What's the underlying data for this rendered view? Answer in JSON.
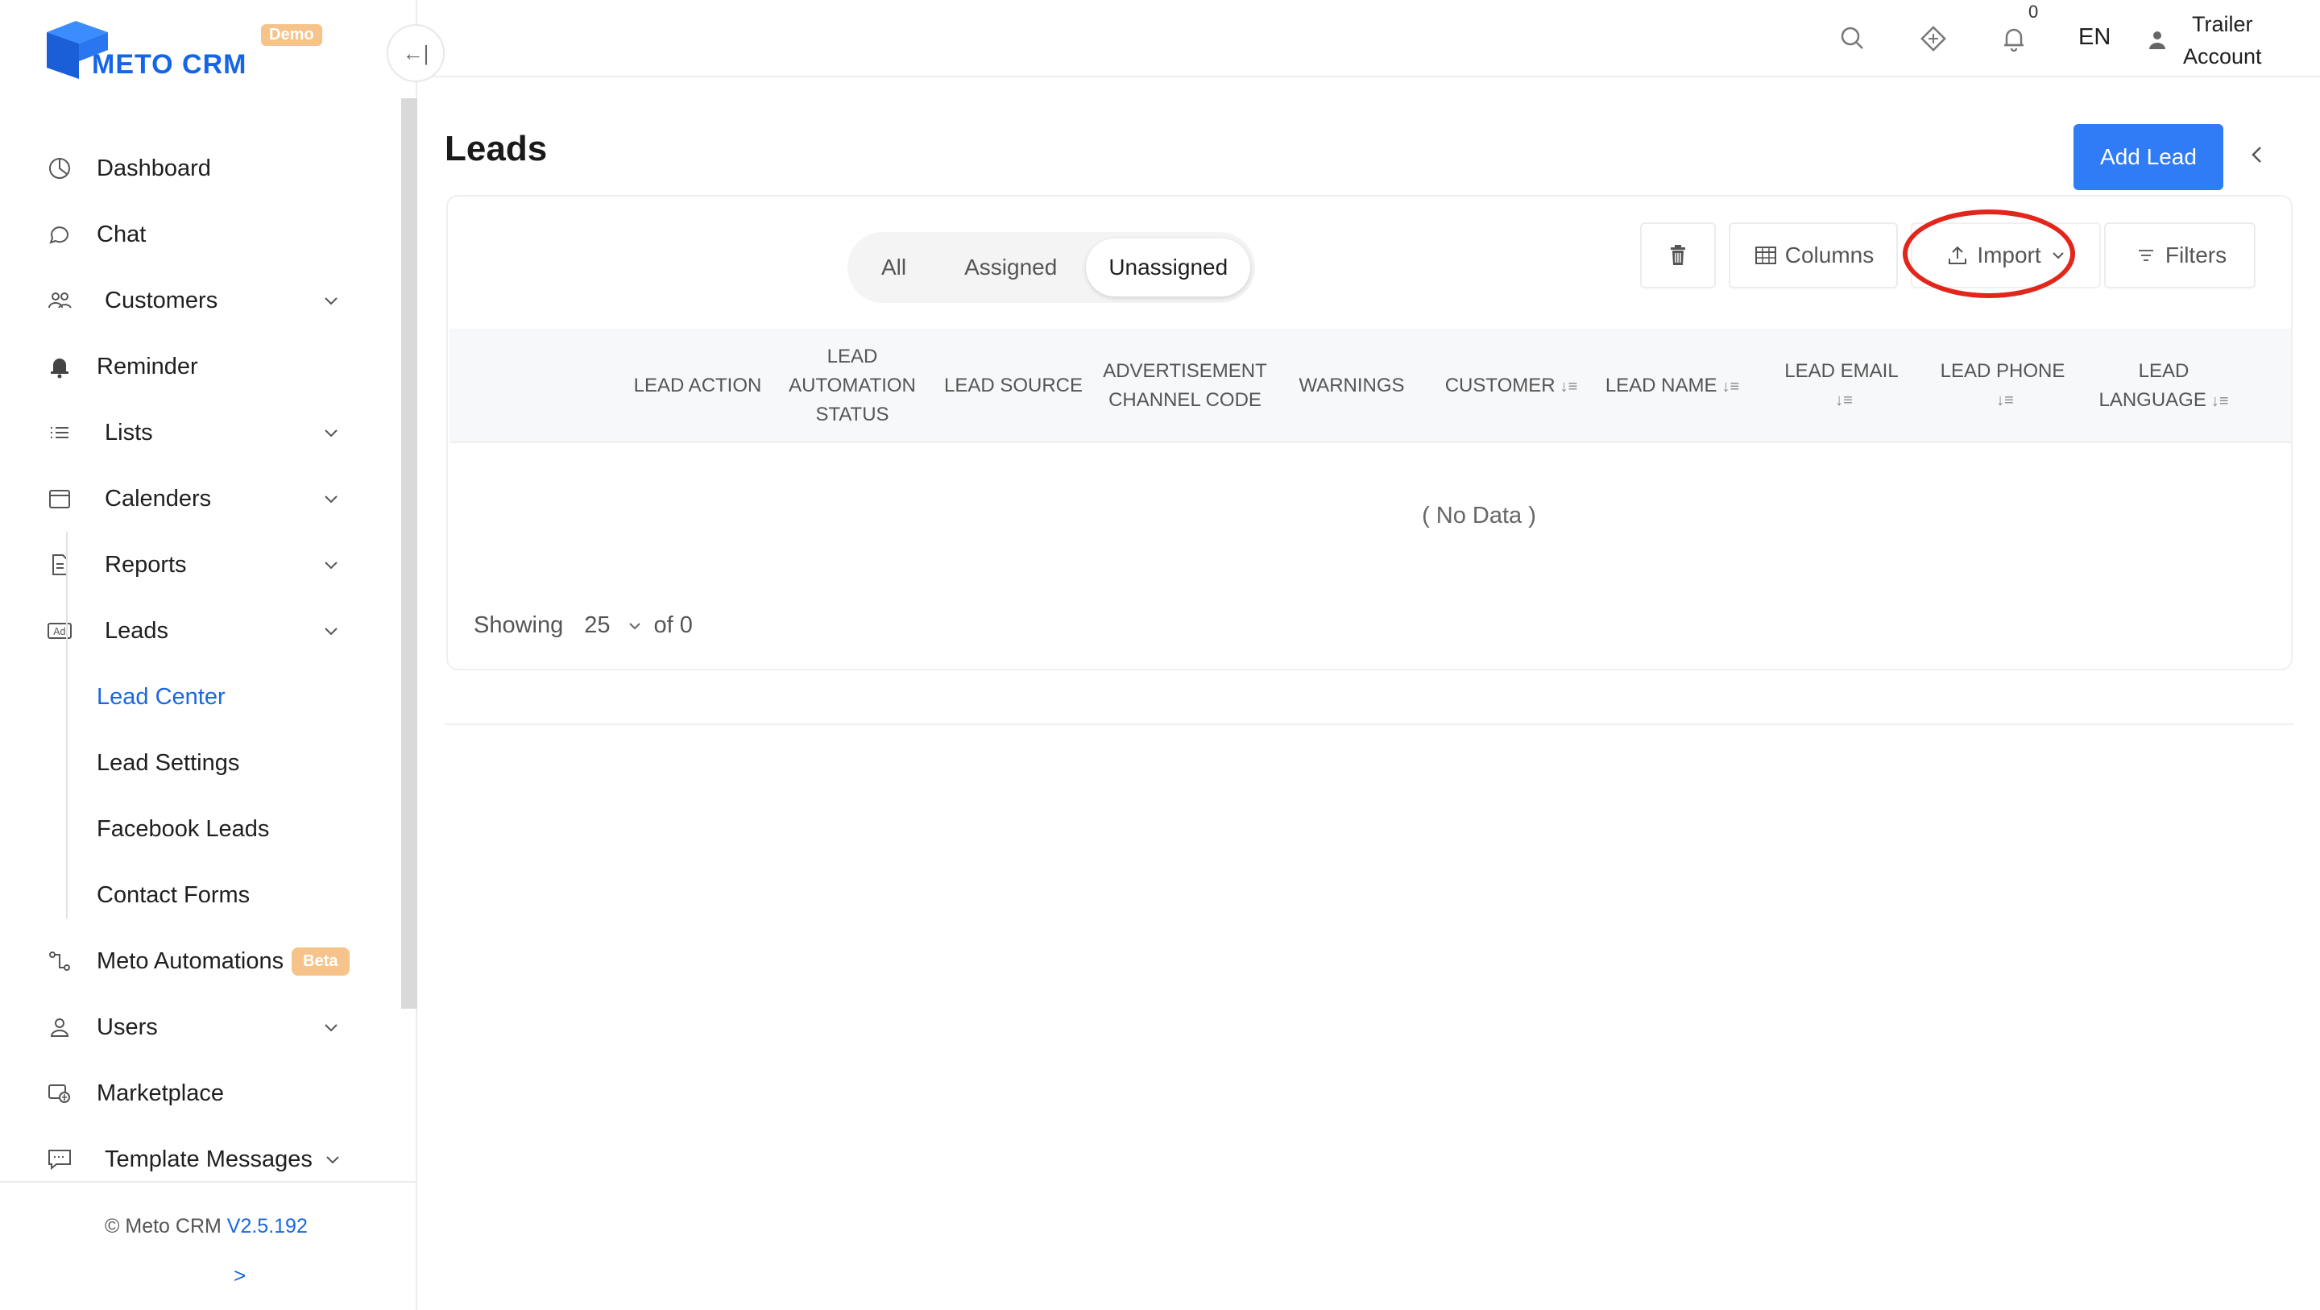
{
  "app": {
    "name": "METO CRM",
    "badge": "Demo"
  },
  "sidebar": {
    "collapse_glyph": "←|",
    "items": [
      {
        "label": "Dashboard",
        "icon": "dashboard-icon"
      },
      {
        "label": "Chat",
        "icon": "chat-icon"
      },
      {
        "label": "Customers",
        "icon": "customers-icon"
      },
      {
        "label": "Reminder",
        "icon": "bell-icon"
      },
      {
        "label": "Lists",
        "icon": "list-icon"
      },
      {
        "label": "Calenders",
        "icon": "calendar-icon"
      },
      {
        "label": "Reports",
        "icon": "report-icon"
      },
      {
        "label": "Leads",
        "icon": "ad-icon"
      },
      {
        "label": "Meto Automations",
        "icon": "automation-icon",
        "badge": "Beta"
      },
      {
        "label": "Users",
        "icon": "user-icon"
      },
      {
        "label": "Marketplace",
        "icon": "marketplace-icon"
      },
      {
        "label": "Template Messages",
        "icon": "template-icon"
      }
    ],
    "leads_sub": [
      {
        "label": "Lead Center",
        "active": true
      },
      {
        "label": "Lead Settings"
      },
      {
        "label": "Facebook Leads"
      },
      {
        "label": "Contact Forms"
      }
    ],
    "footer": {
      "copyright": "© Meto CRM",
      "version": "V2.5.192",
      "expand_glyph": ">"
    }
  },
  "topbar": {
    "notification_count": "0",
    "language": "EN",
    "account_line1": "Trailer",
    "account_line2": "Account"
  },
  "page": {
    "title": "Leads",
    "add_button": "Add Lead",
    "segments": [
      "All",
      "Assigned",
      "Unassigned"
    ],
    "active_segment": "Unassigned",
    "toolbar": {
      "columns": "Columns",
      "import": "Import",
      "filters": "Filters"
    },
    "columns": [
      {
        "line1": "LEAD ACTION"
      },
      {
        "line1": "LEAD",
        "line2": "AUTOMATION",
        "line3": "STATUS"
      },
      {
        "line1": "LEAD SOURCE"
      },
      {
        "line1": "ADVERTISEMENT",
        "line2": "CHANNEL CODE"
      },
      {
        "line1": "WARNINGS"
      },
      {
        "line1": "CUSTOMER",
        "sortable": true
      },
      {
        "line1": "LEAD NAME",
        "sortable": true
      },
      {
        "line1": "LEAD EMAIL",
        "sortable": true
      },
      {
        "line1": "LEAD PHONE",
        "sortable": true
      },
      {
        "line1": "LEAD",
        "line2": "LANGUAGE",
        "sortable": true
      }
    ],
    "sort_glyph": "↓≡",
    "empty_text": "( No Data )",
    "pager": {
      "showing": "Showing",
      "page_size": "25",
      "of": "of 0"
    }
  },
  "colors": {
    "primary": "#2f7cf6",
    "accent_link": "#1a67e0",
    "badge": "#f6c48a",
    "highlight": "#e2261c"
  }
}
